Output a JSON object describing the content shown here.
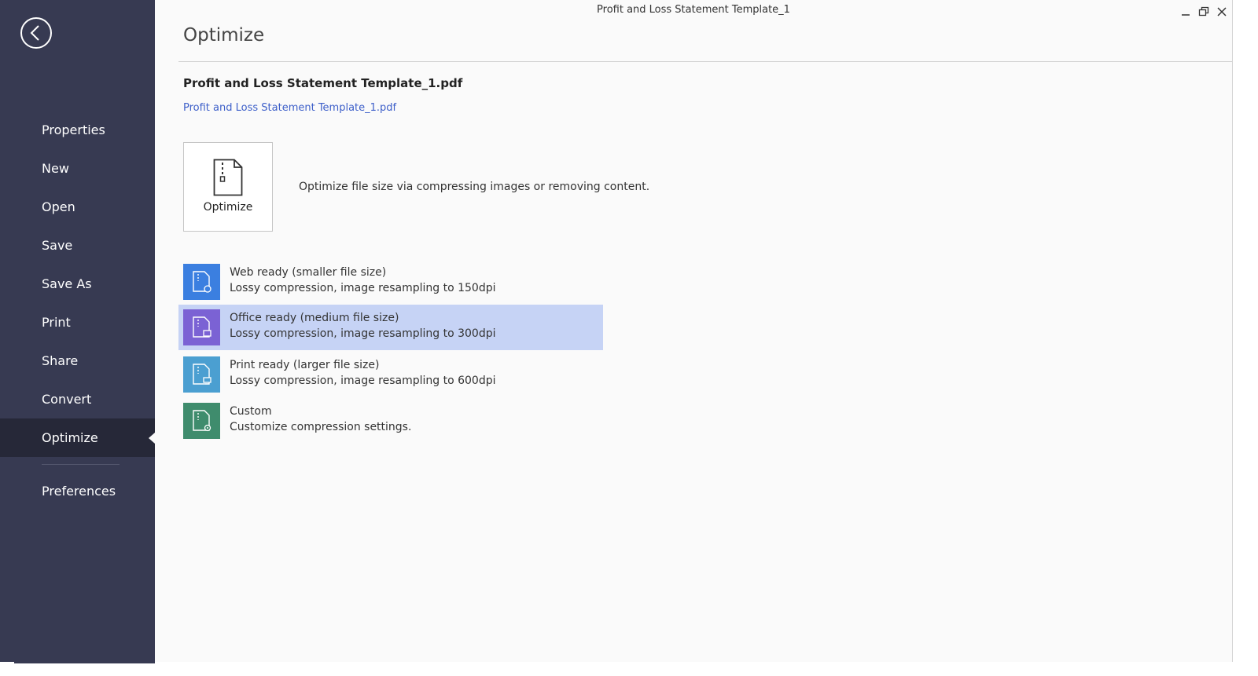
{
  "window": {
    "title": "Profit and Loss Statement Template_1"
  },
  "sidebar": {
    "items": [
      {
        "label": "Properties"
      },
      {
        "label": "New"
      },
      {
        "label": "Open"
      },
      {
        "label": "Save"
      },
      {
        "label": "Save As"
      },
      {
        "label": "Print"
      },
      {
        "label": "Share"
      },
      {
        "label": "Convert"
      },
      {
        "label": "Optimize",
        "active": true
      },
      {
        "label": "Preferences"
      }
    ]
  },
  "main": {
    "page_title": "Optimize",
    "document_name": "Profit and Loss Statement Template_1.pdf",
    "document_link": "Profit and Loss Statement Template_1.pdf",
    "optimize_button_label": "Optimize",
    "optimize_description": "Optimize file size via compressing images or removing content.",
    "presets": [
      {
        "title": "Web ready (smaller file size)",
        "description": "Lossy compression, image resampling to 150dpi",
        "icon": "web-preset-icon",
        "color": "#3b7fe0"
      },
      {
        "title": "Office ready (medium file size)",
        "description": "Lossy compression, image resampling to 300dpi",
        "icon": "office-preset-icon",
        "color": "#7b62d4",
        "selected": true
      },
      {
        "title": "Print ready (larger file size)",
        "description": "Lossy compression, image resampling to 600dpi",
        "icon": "print-preset-icon",
        "color": "#4b9fd1"
      },
      {
        "title": "Custom",
        "description": "Customize compression settings.",
        "icon": "custom-preset-icon",
        "color": "#3f8c6d"
      }
    ]
  },
  "colors": {
    "sidebar_bg": "#373a52",
    "sidebar_active_bg": "#262838",
    "selected_row": "#c6d3f5",
    "link": "#3d5fc9"
  }
}
